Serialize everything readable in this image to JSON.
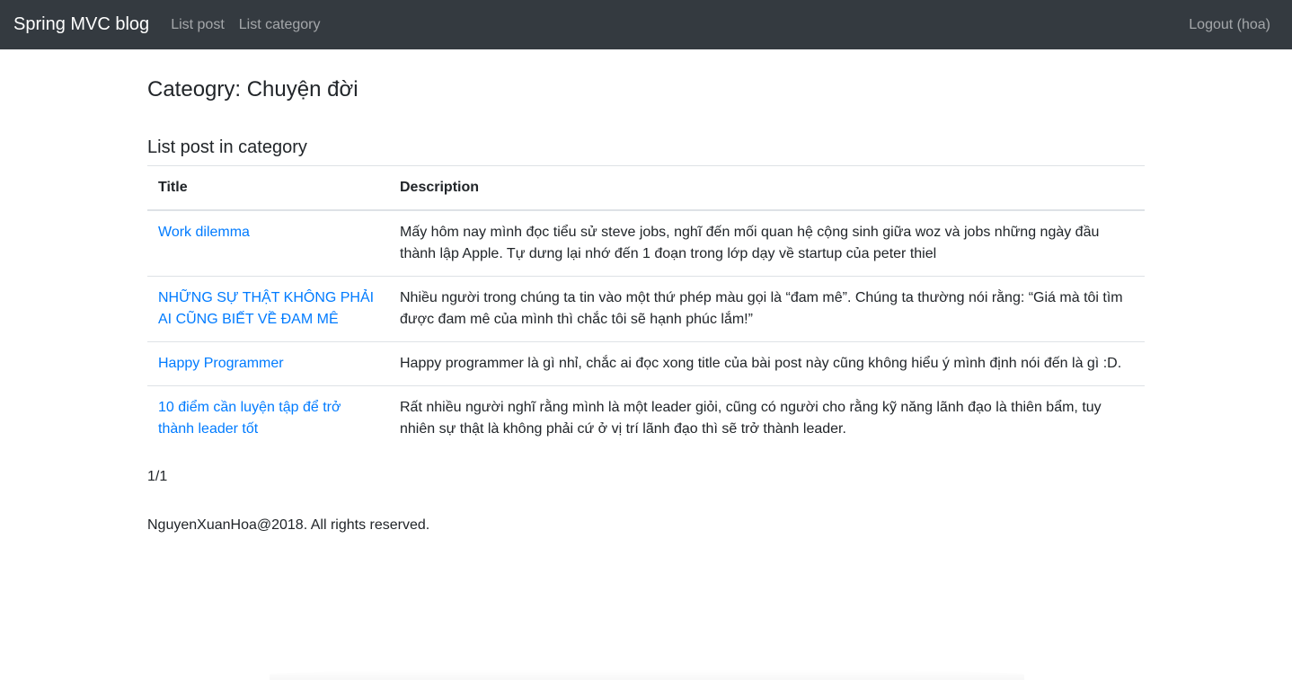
{
  "navbar": {
    "brand": "Spring MVC blog",
    "links": [
      "List post",
      "List category"
    ],
    "logout": "Logout (hoa)"
  },
  "page": {
    "title": "Cateogry: Chuyện đời",
    "section_title": "List post in category"
  },
  "table": {
    "headers": [
      "Title",
      "Description"
    ],
    "rows": [
      {
        "title": "Work dilemma",
        "description": "Mấy hôm nay mình đọc tiểu sử steve jobs, nghĩ đến mối quan hệ cộng sinh giữa woz và jobs những ngày đầu thành lập Apple. Tự dưng lại nhớ đến 1 đoạn trong lớp dạy về startup của peter thiel"
      },
      {
        "title": "NHỮNG SỰ THẬT KHÔNG PHẢI AI CŨNG BIẾT VỀ ĐAM MÊ",
        "description": "Nhiều người trong chúng ta tin vào một thứ phép màu gọi là “đam mê”. Chúng ta thường nói rằng: “Giá mà tôi tìm được đam mê của mình thì chắc tôi sẽ hạnh phúc lắm!”"
      },
      {
        "title": "Happy Programmer",
        "description": "Happy programmer là gì nhỉ, chắc ai đọc xong title của bài post này cũng không hiểu ý mình định nói đến là gì :D."
      },
      {
        "title": "10 điểm cần luyện tập để trở thành leader tốt",
        "description": "Rất nhiều người nghĩ rằng mình là một leader giỏi, cũng có người cho rằng kỹ năng lãnh đạo là thiên bẩm, tuy nhiên sự thật là không phải cứ ở vị trí lãnh đạo thì sẽ trở thành leader."
      }
    ]
  },
  "paging": "1/1",
  "footer": "NguyenXuanHoa@2018. All rights reserved.",
  "colors": {
    "navbar_bg": "#343a40",
    "link": "#007bff",
    "text": "#212529",
    "border": "#dee2e6"
  }
}
